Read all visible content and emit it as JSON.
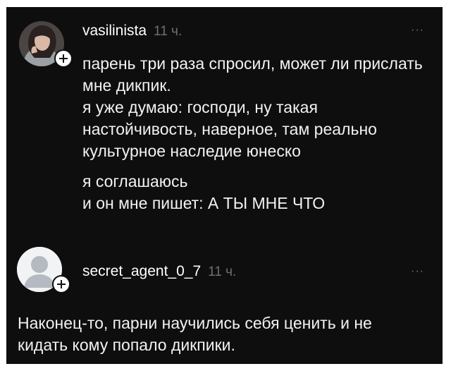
{
  "comments": [
    {
      "username": "vasilinista",
      "time": "11 ч.",
      "more": "···",
      "paragraphs": [
        "парень три раза спросил, может ли прислать мне дикпик.\nя уже думаю: господи, ну такая настойчивость, наверное, там реально культурное наследие юнеско",
        "я соглашаюсь\nи он мне пишет: А ТЫ МНЕ ЧТО"
      ]
    },
    {
      "username": "secret_agent_0_7",
      "time": "11 ч.",
      "more": "···",
      "paragraphs": [
        "Наконец-то, парни научились себя ценить и не кидать кому попало дикпики."
      ]
    }
  ],
  "colors": {
    "background": "#0e0e0f",
    "text": "#f2f2f2",
    "muted": "#6f6f72"
  }
}
